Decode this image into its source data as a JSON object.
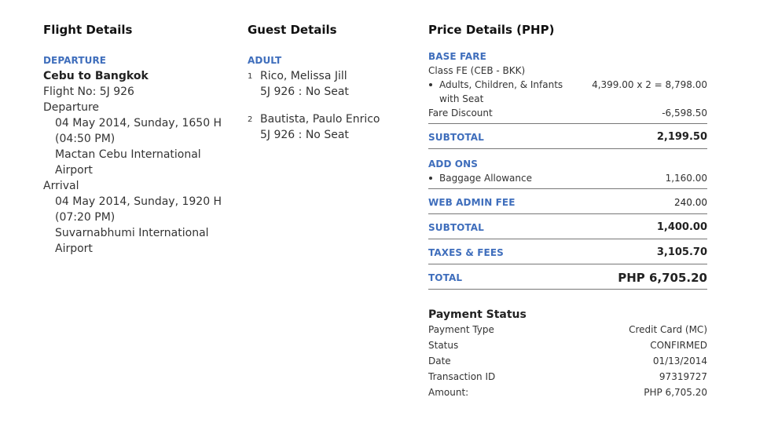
{
  "flight": {
    "title": "Flight Details",
    "departure_label": "DEPARTURE",
    "route": "Cebu to Bangkok",
    "flight_no": "Flight No: 5J 926",
    "departure_heading": "Departure",
    "departure_date": "04 May 2014, Sunday, 1650 H",
    "departure_time": "(04:50 PM)",
    "departure_airport": "Mactan Cebu International Airport",
    "arrival_heading": "Arrival",
    "arrival_date": "04 May 2014, Sunday, 1920 H",
    "arrival_time": "(07:20 PM)",
    "arrival_airport": "Suvarnabhumi International Airport"
  },
  "guests": {
    "title": "Guest Details",
    "adult_label": "ADULT",
    "items": [
      {
        "num": "1",
        "name": "Rico, Melissa Jill",
        "seat": "5J 926 : No Seat"
      },
      {
        "num": "2",
        "name": "Bautista, Paulo Enrico",
        "seat": "5J 926 : No Seat"
      }
    ]
  },
  "price": {
    "title": "Price Details (PHP)",
    "base_fare_label": "BASE FARE",
    "class_line": "Class FE (CEB - BKK)",
    "pax_label": "Adults, Children, & Infants with Seat",
    "pax_value": "4,399.00 x 2 = 8,798.00",
    "discount_label": "Fare Discount",
    "discount_value": "-6,598.50",
    "subtotal1_label": "SUBTOTAL",
    "subtotal1_value": "2,199.50",
    "addons_label": "ADD ONS",
    "baggage_label": "Baggage Allowance",
    "baggage_value": "1,160.00",
    "web_admin_label": "WEB ADMIN FEE",
    "web_admin_value": "240.00",
    "subtotal2_label": "SUBTOTAL",
    "subtotal2_value": "1,400.00",
    "taxes_label": "TAXES & FEES",
    "taxes_value": "3,105.70",
    "total_label": "TOTAL",
    "total_value": "PHP 6,705.20"
  },
  "payment": {
    "title": "Payment Status",
    "rows": [
      {
        "label": "Payment Type",
        "value": "Credit Card (MC)"
      },
      {
        "label": "Status",
        "value": "CONFIRMED"
      },
      {
        "label": "Date",
        "value": "01/13/2014"
      },
      {
        "label": "Transaction ID",
        "value": "97319727"
      },
      {
        "label": "Amount:",
        "value": "PHP 6,705.20"
      }
    ]
  }
}
